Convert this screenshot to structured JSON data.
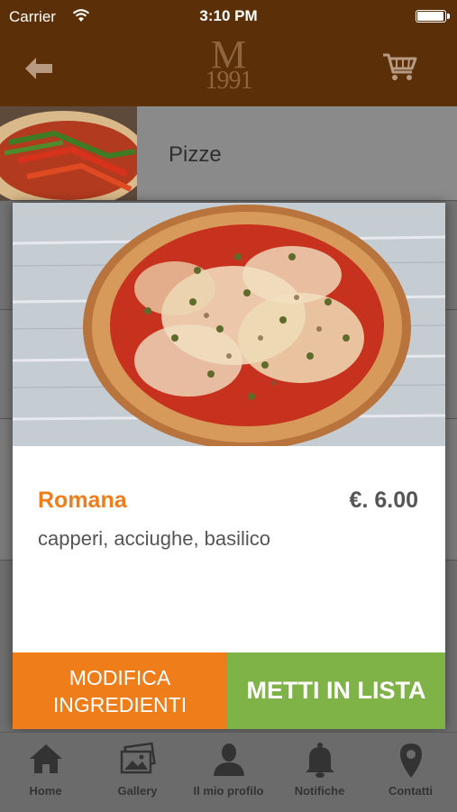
{
  "status": {
    "carrier": "Carrier",
    "time": "3:10 PM",
    "battery_level": 1.0
  },
  "nav": {
    "logo_letter": "M",
    "logo_year": "1991",
    "back_icon": "back-arrow-icon",
    "cart_icon": "cart-icon"
  },
  "list": {
    "category": "Pizze"
  },
  "product": {
    "name": "Romana",
    "price": "€. 6.00",
    "ingredients": "capperi, acciughe, basilico",
    "modify_line1": "MODIFICA",
    "modify_line2": "INGREDIENTI",
    "add_label": "METTI IN LISTA"
  },
  "tabs": [
    {
      "label": "Home",
      "icon": "home-icon"
    },
    {
      "label": "Gallery",
      "icon": "gallery-icon"
    },
    {
      "label": "Il mio profilo",
      "icon": "profile-icon"
    },
    {
      "label": "Notifiche",
      "icon": "bell-icon"
    },
    {
      "label": "Contatti",
      "icon": "location-pin-icon"
    }
  ],
  "colors": {
    "brown": "#5b3008",
    "orange": "#ef7d1a",
    "green": "#7fb247"
  }
}
